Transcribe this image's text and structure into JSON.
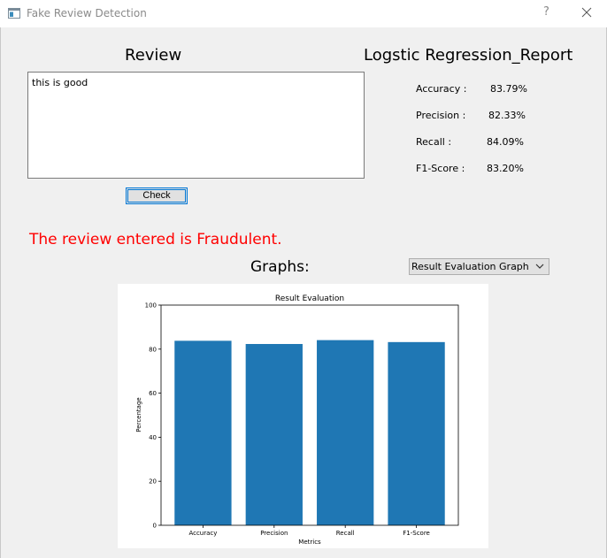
{
  "window": {
    "title": "Fake Review Detection",
    "help": "?"
  },
  "review": {
    "heading": "Review",
    "text": "this is good",
    "check_label": "Check"
  },
  "report": {
    "heading": "Logstic Regression_Report",
    "metrics": [
      {
        "label": "Accuracy :",
        "value": "83.79%"
      },
      {
        "label": "Precision :",
        "value": "82.33%"
      },
      {
        "label": "Recall :",
        "value": "84.09%"
      },
      {
        "label": "F1-Score :",
        "value": "83.20%"
      }
    ]
  },
  "result": {
    "message": "The review entered is Fraudulent.",
    "color": "#ff0000"
  },
  "graphs": {
    "heading": "Graphs:",
    "selected": "Result Evaluation Graph"
  },
  "chart_data": {
    "type": "bar",
    "title": "Result Evaluation",
    "xlabel": "Metrics",
    "ylabel": "Percentage",
    "categories": [
      "Accuracy",
      "Precision",
      "Recall",
      "F1-Score"
    ],
    "values": [
      83.79,
      82.33,
      84.09,
      83.2
    ],
    "ylim": [
      0,
      100
    ],
    "yticks": [
      0,
      20,
      40,
      60,
      80,
      100
    ],
    "bar_color": "#1f77b4",
    "grid": false
  }
}
